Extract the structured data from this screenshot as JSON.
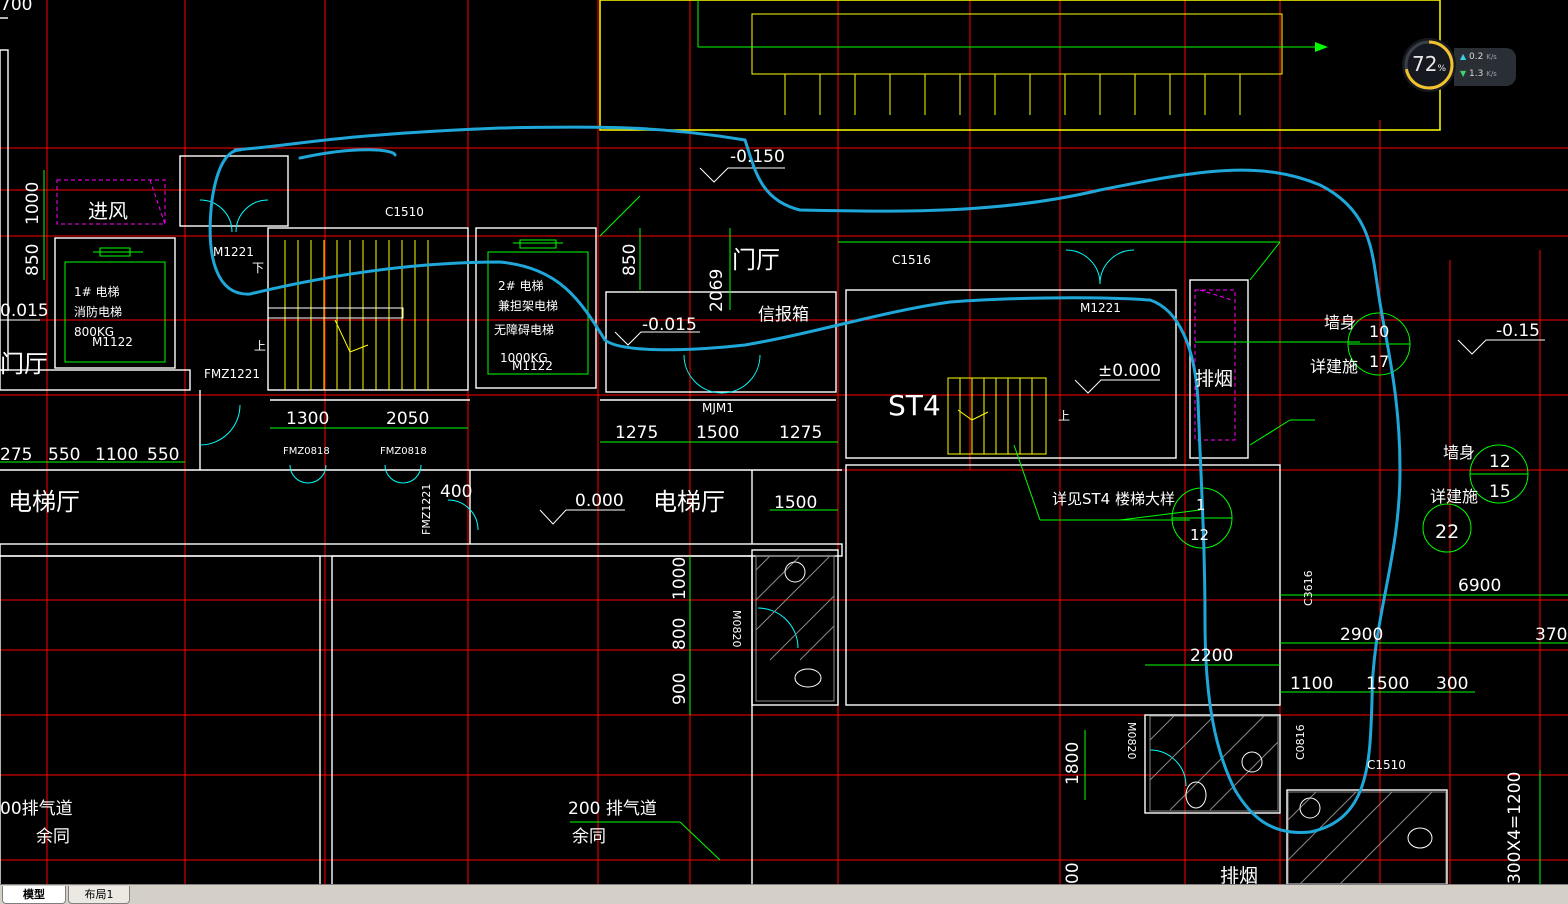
{
  "tabs": [
    {
      "label": "模型",
      "active": true
    },
    {
      "label": "布局1",
      "active": false
    }
  ],
  "net_monitor": {
    "percent": "72",
    "percent_unit": "%",
    "upload": "0.2",
    "download": "1.3",
    "unit": "K/s",
    "ring_color": "#f2c12e",
    "ring_color_2": "#36c7e8"
  },
  "colors": {
    "background": "#000000",
    "axis": "#ff0000",
    "wall": "#ffffff",
    "dimension": "#00ff00",
    "stair": "#ffff00",
    "markup": "#1ea7d8",
    "door": "#00ffff",
    "vent": "#ff00ff"
  },
  "drawing": {
    "room_labels": [
      {
        "text": "进风"
      },
      {
        "text": "门厅"
      },
      {
        "text": "电梯厅"
      },
      {
        "text": "电梯厅"
      },
      {
        "text": "信报箱"
      },
      {
        "text": "排烟"
      },
      {
        "text": "排烟"
      },
      {
        "text": "ST4"
      },
      {
        "text": "门厅"
      }
    ],
    "elevator_1": [
      "1# 电梯",
      "消防电梯",
      "800KG"
    ],
    "elevator_2": [
      "2# 电梯",
      "兼担架电梯",
      "无障碍电梯",
      "1000KG"
    ],
    "elevations": [
      "-0.150",
      "-0.015",
      "±0.000",
      "0.000",
      "-0.15",
      "0.015"
    ],
    "door_window_tags": [
      "C1510",
      "M1221",
      "M1221",
      "FMZ1221",
      "FMZ0818",
      "FMZ0818",
      "FMZ1221",
      "MJM1",
      "C1516",
      "M1122",
      "M1122",
      "M0820",
      "M0820",
      "C3616",
      "C0816",
      "C1510"
    ],
    "stair_marks": {
      "up": "上",
      "down": "下"
    },
    "dimensions": [
      "700",
      "1000",
      "850",
      "850",
      "2069",
      "1300",
      "2050",
      "1275",
      "1500",
      "1275",
      "275",
      "550",
      "1100",
      "550",
      "400",
      "1500",
      "1000",
      "800",
      "900",
      "1800",
      "2200",
      "6900",
      "2900",
      "370",
      "1100",
      "1500",
      "300",
      "300X4=1200",
      "00"
    ],
    "detail_ref": "详见ST4 楼梯大样",
    "detail_circle": [
      "1",
      "12"
    ],
    "wall_refs": [
      {
        "title": "墙身",
        "note": "详建施",
        "num_top": "10",
        "num_bottom": "17"
      },
      {
        "title": "墙身",
        "note": "详建施",
        "num_top": "12",
        "num_bottom": "15",
        "sheet": "22"
      }
    ],
    "vent_notes": [
      {
        "line1": "00排气道",
        "line2": "余同"
      },
      {
        "line1": "200 排气道",
        "line2": "余同"
      }
    ]
  }
}
